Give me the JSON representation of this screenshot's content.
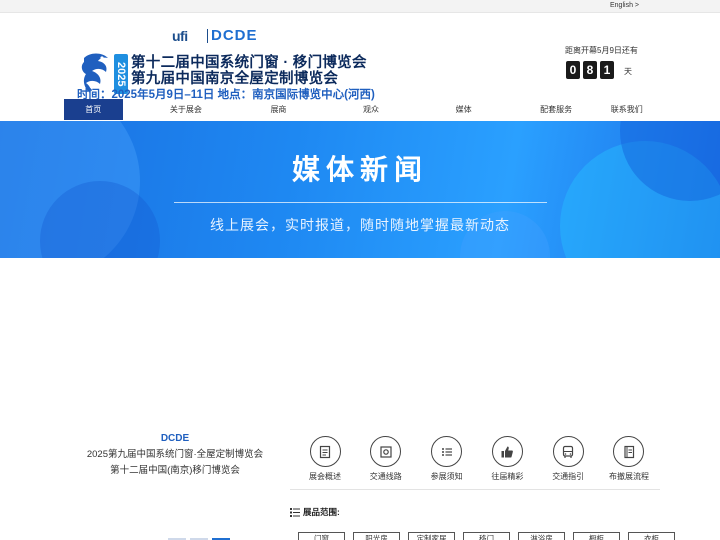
{
  "topbar": {
    "language_link": "English >"
  },
  "header": {
    "ufi_logo": "ufi",
    "dcde_logo": "DCDE",
    "year": "2025",
    "title_line1": "第十二届中国系统门窗 · 移门博览会",
    "title_line2": "第九届中国南京全屋定制博览会",
    "time_info": "时间：2025年5月9日–11日  地点：南京国际博览中心(河西)"
  },
  "countdown": {
    "label": "距离开幕5月9日还有",
    "digits": [
      "0",
      "8",
      "1"
    ],
    "unit": "天"
  },
  "nav": {
    "items": [
      {
        "label": "首页",
        "active": true
      },
      {
        "label": "关于展会"
      },
      {
        "label": "展商"
      },
      {
        "label": "观众"
      },
      {
        "label": "媒体"
      },
      {
        "label": "配套服务"
      },
      {
        "label": "联系我们"
      }
    ]
  },
  "banner": {
    "title": "媒体新闻",
    "subtitle": "线上展会，实时报道，随时随地掌握最新动态"
  },
  "footer": {
    "brand_name": "DCDE",
    "brand_line1": "2025第九届中国系统门窗·全屋定制博览会",
    "brand_line2": "第十二届中国(南京)移门博览会",
    "quicklinks": [
      {
        "label": "展会概述",
        "icon": "document-icon"
      },
      {
        "label": "交通线路",
        "icon": "gear-icon"
      },
      {
        "label": "参展须知",
        "icon": "list-icon"
      },
      {
        "label": "往届精彩",
        "icon": "thumbs-up-icon"
      },
      {
        "label": "交通指引",
        "icon": "bus-icon"
      },
      {
        "label": "布撤展流程",
        "icon": "notebook-icon"
      }
    ],
    "scope_label": "展品范围:",
    "scope_tags": [
      "门窗",
      "阳光房",
      "定制家居",
      "移门",
      "淋浴房",
      "橱柜",
      "衣柜"
    ]
  }
}
